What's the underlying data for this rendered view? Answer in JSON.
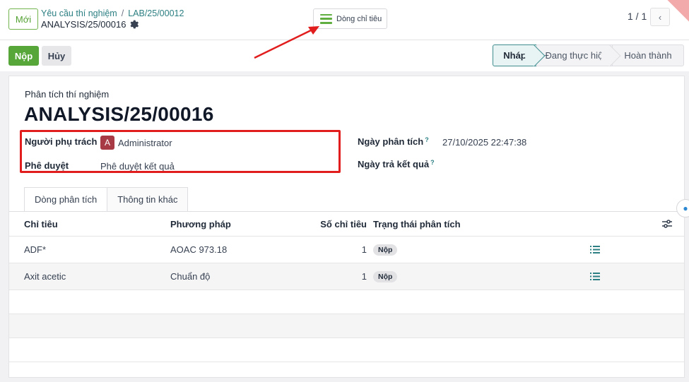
{
  "topbar": {
    "new_button": "Mới",
    "breadcrumb_parent": "Yêu cầu thí nghiệm",
    "breadcrumb_separator": "/",
    "breadcrumb_current": "LAB/25/00012",
    "record_name": "ANALYSIS/25/00016",
    "center_button": "Dòng chỉ tiêu",
    "pager": "1 / 1"
  },
  "actions": {
    "submit": "Nộp",
    "cancel": "Hủy"
  },
  "stages": [
    "Nháp",
    "Đang thực hiện",
    "Hoàn thành"
  ],
  "form": {
    "label_top": "Phân tích thí nghiệm",
    "title": "ANALYSIS/25/00016",
    "fields": {
      "owner_label": "Người phụ trách",
      "owner_avatar": "A",
      "owner_value": "Administrator",
      "approval_label": "Phê duyệt",
      "approval_value": "Phê duyệt kết quả",
      "analysis_date_label": "Ngày phân tích",
      "analysis_date_value": "27/10/2025 22:47:38",
      "result_date_label": "Ngày trả kết quả",
      "help_mark": "?"
    }
  },
  "tabs": [
    "Dòng phân tích",
    "Thông tin khác"
  ],
  "table": {
    "headers": [
      "Chỉ tiêu",
      "Phương pháp",
      "Số chỉ tiêu",
      "Trạng thái phân tích"
    ],
    "rows": [
      {
        "indicator": "ADF*",
        "method": "AOAC 973.18",
        "count": "1",
        "status": "Nộp"
      },
      {
        "indicator": "Axit acetic",
        "method": "Chuẩn độ",
        "count": "1",
        "status": "Nộp"
      }
    ]
  },
  "colors": {
    "primary": "#57a63a",
    "link": "#2c7f82",
    "highlight": "#e11d1d"
  }
}
